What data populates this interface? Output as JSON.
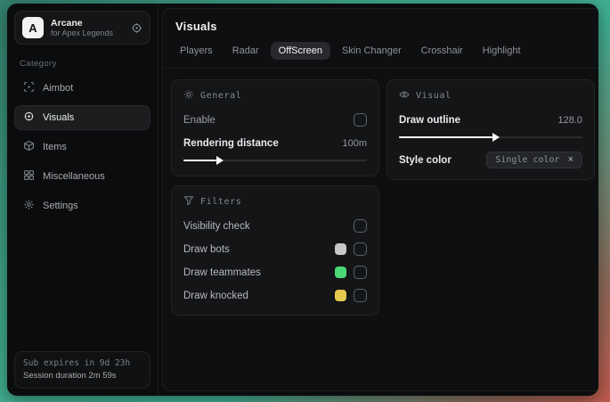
{
  "app": {
    "name": "Arcane",
    "subtitle": "for Apex Legends",
    "logo_letter": "A"
  },
  "sidebar": {
    "category_label": "Category",
    "items": [
      {
        "label": "Aimbot",
        "icon": "crosshair-icon",
        "selected": false
      },
      {
        "label": "Visuals",
        "icon": "eye-target-icon",
        "selected": true
      },
      {
        "label": "Items",
        "icon": "box-icon",
        "selected": false
      },
      {
        "label": "Miscellaneous",
        "icon": "grid-icon",
        "selected": false
      },
      {
        "label": "Settings",
        "icon": "gear-icon",
        "selected": false
      }
    ],
    "footer": {
      "sub_expires": "Sub expires in 9d 23h",
      "session_duration": "Session duration 2m 59s"
    }
  },
  "main": {
    "title": "Visuals",
    "tabs": [
      {
        "label": "Players",
        "selected": false
      },
      {
        "label": "Radar",
        "selected": false
      },
      {
        "label": "OffScreen",
        "selected": true
      },
      {
        "label": "Skin Changer",
        "selected": false
      },
      {
        "label": "Crosshair",
        "selected": false
      },
      {
        "label": "Highlight",
        "selected": false
      }
    ],
    "panels": {
      "general": {
        "title": "General",
        "icon": "sun-icon",
        "enable": {
          "label": "Enable",
          "checked": false
        },
        "rendering_distance": {
          "label": "Rendering distance",
          "value": "100m",
          "fill": "18%"
        }
      },
      "visual": {
        "title": "Visual",
        "icon": "eye-icon",
        "draw_outline": {
          "label": "Draw outline",
          "value": "128.0",
          "fill": "51%"
        },
        "style_color": {
          "label": "Style color",
          "value": "Single color",
          "clear_glyph": "×"
        }
      },
      "filters": {
        "title": "Filters",
        "icon": "funnel-icon",
        "rows": [
          {
            "label": "Visibility check",
            "checked": false
          },
          {
            "label": "Draw bots",
            "swatch": "#c7c7c7",
            "checked": false
          },
          {
            "label": "Draw teammates",
            "swatch": "#4bd977",
            "checked": false
          },
          {
            "label": "Draw knocked",
            "swatch": "#e5c84f",
            "checked": false
          }
        ]
      }
    }
  },
  "colors": {
    "accent_teal": "#3fae92",
    "accent_red": "#bf5a4c",
    "window_bg": "#0b0c0d",
    "card_bg": "#141517",
    "slider_fill": "#ffffff"
  }
}
